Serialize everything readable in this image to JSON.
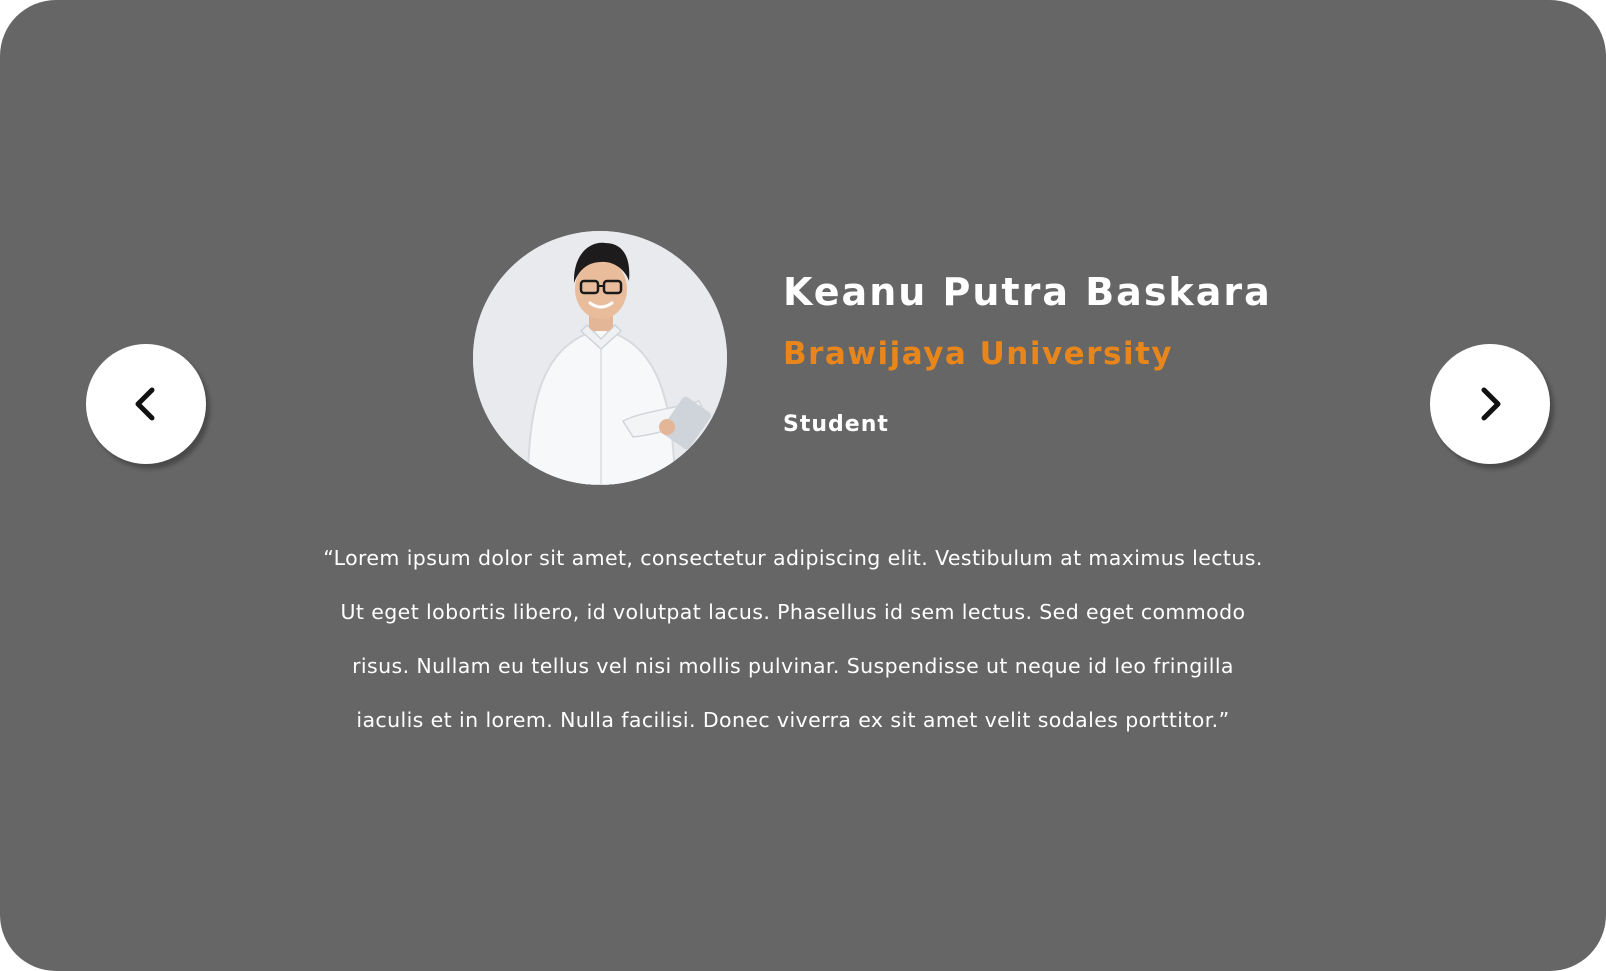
{
  "testimonial": {
    "name": "Keanu Putra Baskara",
    "university": "Brawijaya University",
    "role": "Student",
    "quote": "“Lorem ipsum dolor sit amet, consectetur adipiscing elit. Vestibulum at maximus lectus. Ut eget lobortis libero, id volutpat lacus. Phasellus id sem lectus. Sed eget commodo risus. Nullam eu tellus vel nisi mollis pulvinar. Suspendisse ut neque id leo fringilla iaculis et in lorem. Nulla facilisi. Donec viverra ex sit amet velit sodales porttitor.”"
  },
  "navigation": {
    "prev_icon": "chevron-left-icon",
    "next_icon": "chevron-right-icon"
  },
  "colors": {
    "card_background": "#666666",
    "accent": "#e8861c",
    "text": "#ffffff",
    "button_background": "#ffffff",
    "icon": "#111111"
  }
}
